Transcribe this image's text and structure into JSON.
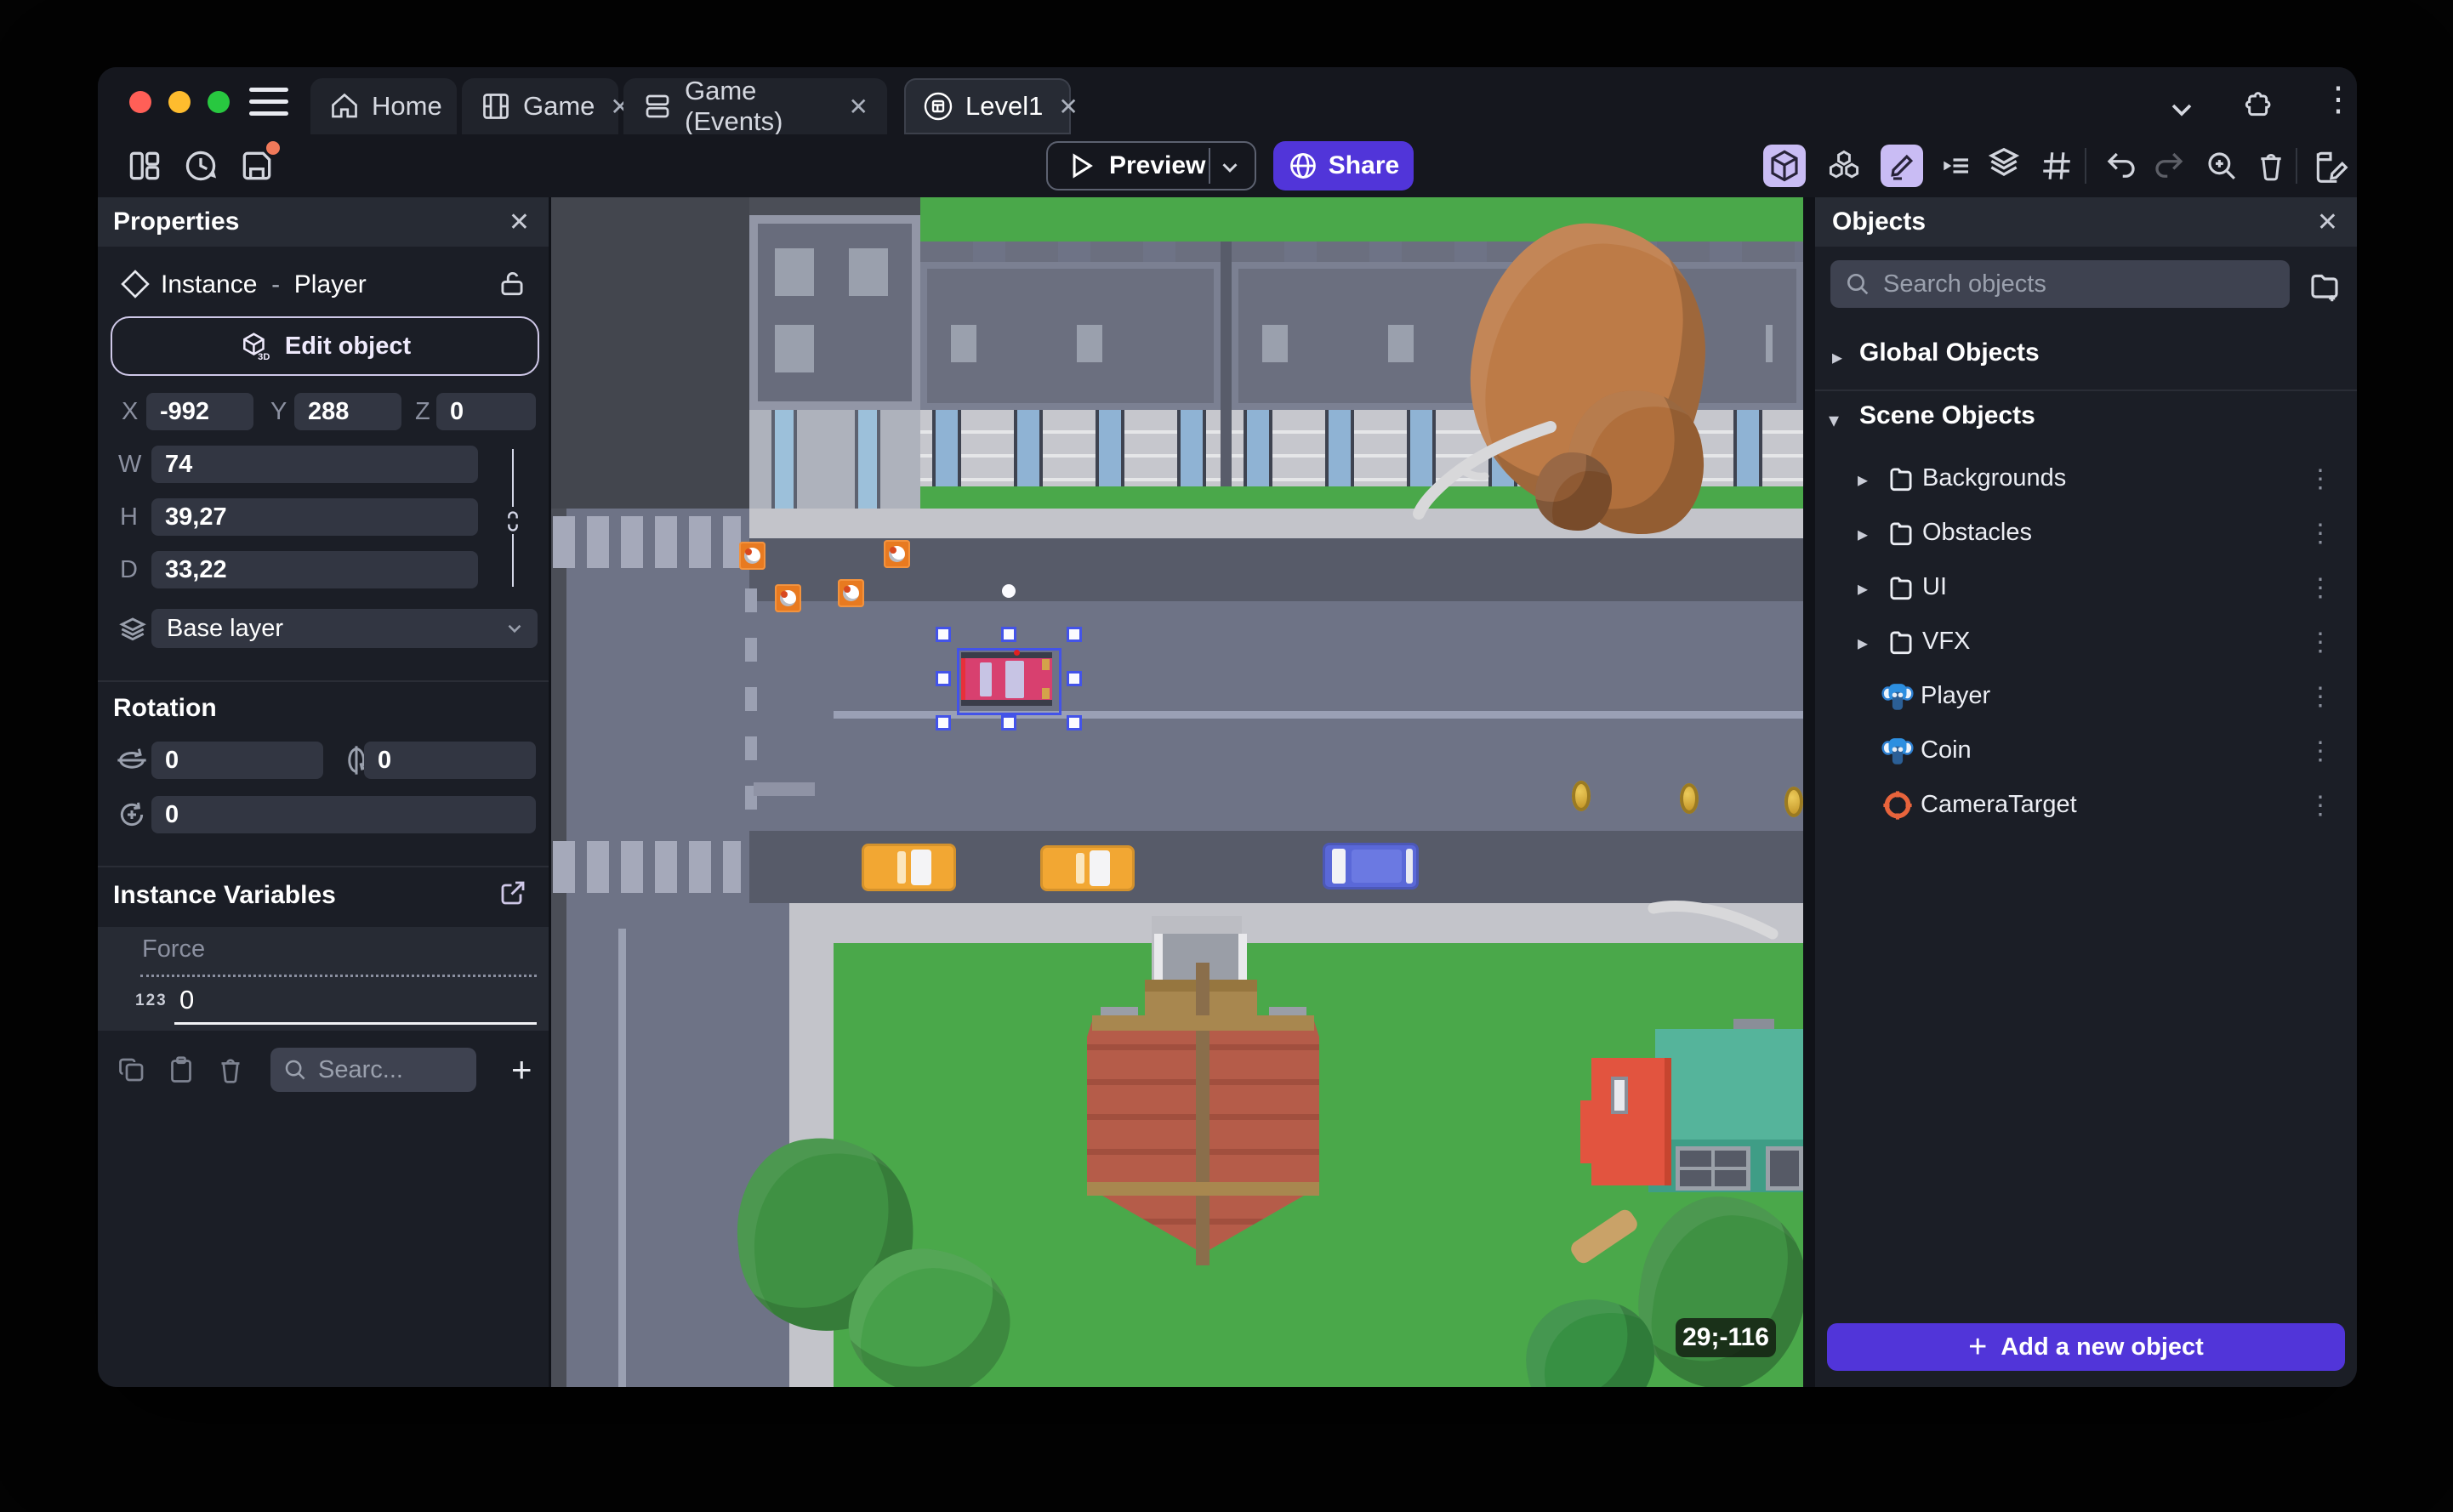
{
  "tabs": [
    {
      "label": "Home"
    },
    {
      "label": "Game"
    },
    {
      "label": "Game (Events)"
    },
    {
      "label": "Level1"
    }
  ],
  "toolbar": {
    "preview_label": "Preview",
    "share_label": "Share"
  },
  "properties_panel": {
    "title": "Properties",
    "instance_type": "Instance",
    "separator": "-",
    "instance_name": "Player",
    "edit_object_label": "Edit object",
    "coords": {
      "x_label": "X",
      "x": "-992",
      "y_label": "Y",
      "y": "288",
      "z_label": "Z",
      "z": "0"
    },
    "size": {
      "w_label": "W",
      "w": "74",
      "h_label": "H",
      "h": "39,27",
      "d_label": "D",
      "d": "33,22"
    },
    "layer": {
      "value": "Base layer"
    },
    "rotation_title": "Rotation",
    "rotation": {
      "rx": "0",
      "ry": "0",
      "rz": "0"
    },
    "variables_title": "Instance Variables",
    "variable": {
      "name": "Force",
      "type_badge": "123",
      "value": "0"
    },
    "search_placeholder": "Searc..."
  },
  "objects_panel": {
    "title": "Objects",
    "search_placeholder": "Search objects",
    "global_group_label": "Global Objects",
    "scene_group_label": "Scene Objects",
    "tree": [
      {
        "label": "Backgrounds"
      },
      {
        "label": "Obstacles"
      },
      {
        "label": "UI"
      },
      {
        "label": "VFX"
      },
      {
        "label": "Player"
      },
      {
        "label": "Coin"
      },
      {
        "label": "CameraTarget"
      }
    ],
    "add_button_label": "Add a new object"
  },
  "canvas": {
    "cursor_coords": "29;-116"
  },
  "glyphs": {
    "close": "✕",
    "kebab": "⋮",
    "tri_right": "▸",
    "tri_down": "▾",
    "plus": "+"
  },
  "colors": {
    "accent": "#5135d9",
    "toolbar_highlight": "#c9bcf4",
    "traffic_red": "#ff5f57",
    "traffic_yellow": "#febc2e",
    "traffic_green": "#28c840",
    "save_dot": "#f0795a"
  }
}
